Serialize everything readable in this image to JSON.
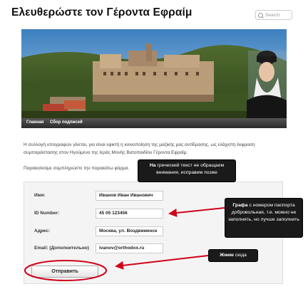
{
  "header": {
    "site_title": "Ελευθερώστε τον Γέροντα Εφραίμ",
    "search_placeholder": "Search"
  },
  "nav": {
    "items": [
      "Главная",
      "Сбор подписей"
    ]
  },
  "content": {
    "intro": "Η συλλογή υπογραφών γίνεται, για είναι εφικτή η κοινοποίηση της μαζικής μας αντίδρασης, ως ελάχιστη έκφραση συμπαράστασης στον Ηγούμενο της Ιεράς Μονής Βατοπαιδίου Γέροντα Εφραίμ.",
    "please": "Παρακαλούμε συμπληρώστε την παρακάτω φόρμα."
  },
  "form": {
    "fields": [
      {
        "label": "Имя:",
        "value": "Иванов Иван Иванович"
      },
      {
        "label": "ID Number:",
        "value": "45 05 123456"
      },
      {
        "label": "Адрес:",
        "value": "Москва, ул. Воздвиженск"
      },
      {
        "label": "Email: (Дополнительно)",
        "value": "ivanov@orthodox.ru"
      }
    ],
    "submit_label": "Отправить"
  },
  "callouts": {
    "greek_bold": "На",
    "greek_rest": "греческий текст не обращаем внимания, исправим позже",
    "id_bold": "Графа",
    "id_rest": "с номером паспорта добровольная, т.е. можно не заполнять, но лучше заполнить",
    "click_bold": "Жмем",
    "click_rest": "сюда"
  },
  "colors": {
    "annotation_red": "#d0021b",
    "navbar": "#333333",
    "callout_bg": "#1a1a1a"
  }
}
